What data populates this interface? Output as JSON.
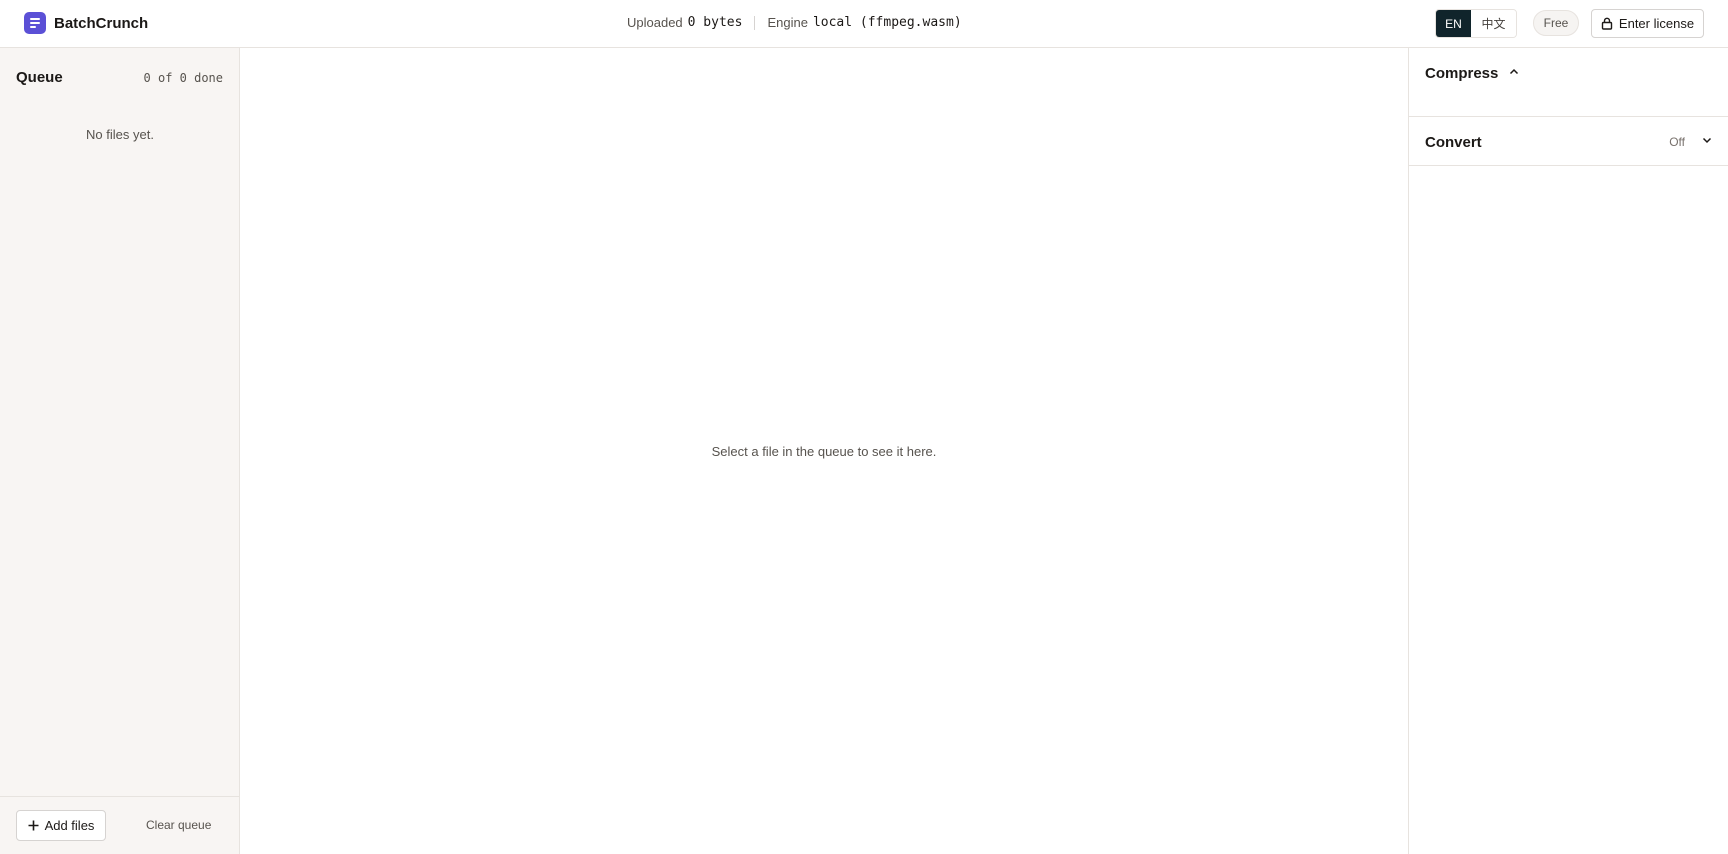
{
  "header": {
    "brand": "BatchCrunch",
    "uploaded_label": "Uploaded",
    "uploaded_value": "0 bytes",
    "engine_label": "Engine",
    "engine_value": "local (ffmpeg.wasm)",
    "languages": [
      "EN",
      "中文"
    ],
    "active_language": "EN",
    "plan": "Free",
    "license_button": "Enter license"
  },
  "sidebar": {
    "title": "Queue",
    "count": "0 of 0 done",
    "empty_text": "No files yet.",
    "add_button": "Add files",
    "clear_button": "Clear queue"
  },
  "main": {
    "empty_text": "Select a file in the queue to see it here."
  },
  "panel": {
    "sections": [
      {
        "title": "Compress",
        "state": "",
        "expanded": true
      },
      {
        "title": "Convert",
        "state": "Off",
        "expanded": false
      }
    ]
  },
  "colors": {
    "accent": "#5b50d6",
    "active_lang_bg": "#10242b",
    "sidebar_bg": "#f8f5f3"
  },
  "icons": [
    "logo-icon",
    "lock-icon",
    "plus-icon",
    "chevron-up-icon",
    "chevron-down-icon"
  ]
}
